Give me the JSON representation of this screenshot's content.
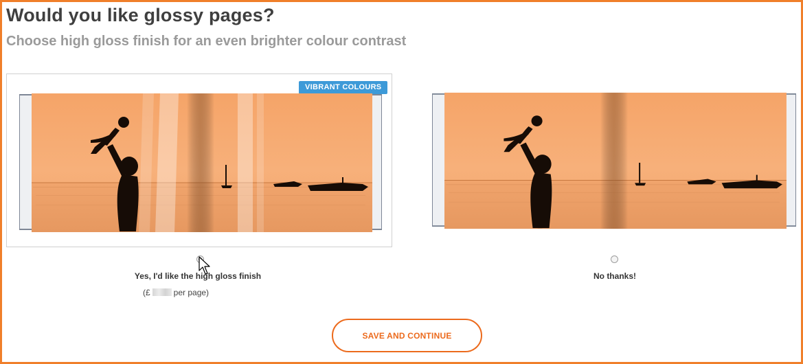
{
  "heading": {
    "title": "Would you like glossy pages?",
    "subtitle": "Choose high gloss finish for an even brighter colour contrast"
  },
  "options": [
    {
      "badge": "VIBRANT COLOURS",
      "label": "Yes, I'd like the high gloss finish",
      "price_prefix": "(£",
      "price_suffix": "per page)",
      "selected": true
    },
    {
      "label": "No thanks!",
      "selected": false
    }
  ],
  "actions": {
    "save_label": "SAVE AND CONTINUE"
  },
  "colors": {
    "accent": "#f07f2a",
    "button": "#ec6a1c",
    "badge": "#3d9ad8"
  }
}
